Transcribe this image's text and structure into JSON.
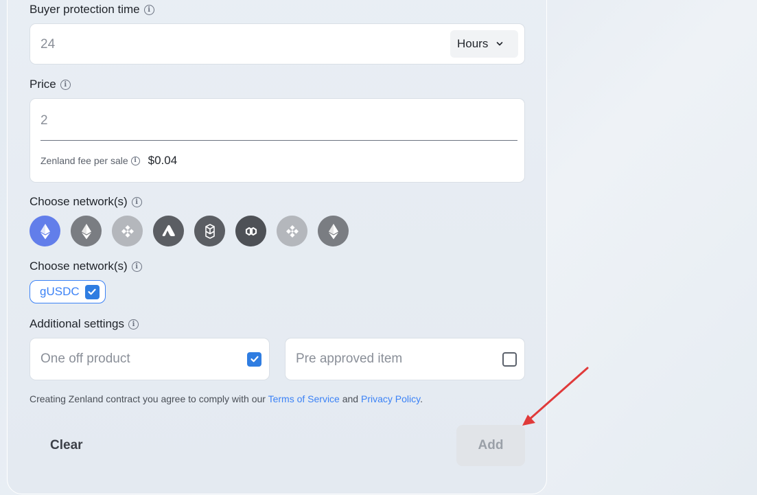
{
  "buyer_protection": {
    "label": "Buyer protection time",
    "value": "24",
    "unit_select": "Hours"
  },
  "price": {
    "label": "Price",
    "value": "2",
    "fee_label": "Zenland fee per sale",
    "fee_value": "$0.04"
  },
  "networks": {
    "label": "Choose network(s)",
    "items": [
      {
        "icon": "ethereum-icon",
        "selected": true,
        "color": "#627eea"
      },
      {
        "icon": "ethereum-icon",
        "selected": false,
        "color": "#7a7d82"
      },
      {
        "icon": "bnb-icon",
        "selected": false,
        "color": "#b4b7bc"
      },
      {
        "icon": "avalanche-icon",
        "selected": false,
        "color": "#5b5e63"
      },
      {
        "icon": "fantom-icon",
        "selected": false,
        "color": "#5b5e63"
      },
      {
        "icon": "polygon-icon",
        "selected": false,
        "color": "#4e5156"
      },
      {
        "icon": "bnb-icon",
        "selected": false,
        "color": "#b4b7bc"
      },
      {
        "icon": "ethereum-icon",
        "selected": false,
        "color": "#7a7d82"
      }
    ]
  },
  "tokens": {
    "label": "Choose network(s)",
    "items": [
      {
        "label": "gUSDC",
        "checked": true
      }
    ]
  },
  "additional_settings": {
    "label": "Additional settings",
    "one_off": {
      "label": "One off product",
      "checked": true
    },
    "pre_approved": {
      "label": "Pre approved item",
      "checked": false
    }
  },
  "terms": {
    "prefix": "Creating Zenland contract you agree to comply with our ",
    "tos": "Terms of Service",
    "and": " and ",
    "privacy": "Privacy Policy",
    "suffix": "."
  },
  "actions": {
    "clear_label": "Clear",
    "add_label": "Add"
  },
  "colors": {
    "accent": "#3b82f6",
    "annotation_arrow": "#e03a3a"
  }
}
